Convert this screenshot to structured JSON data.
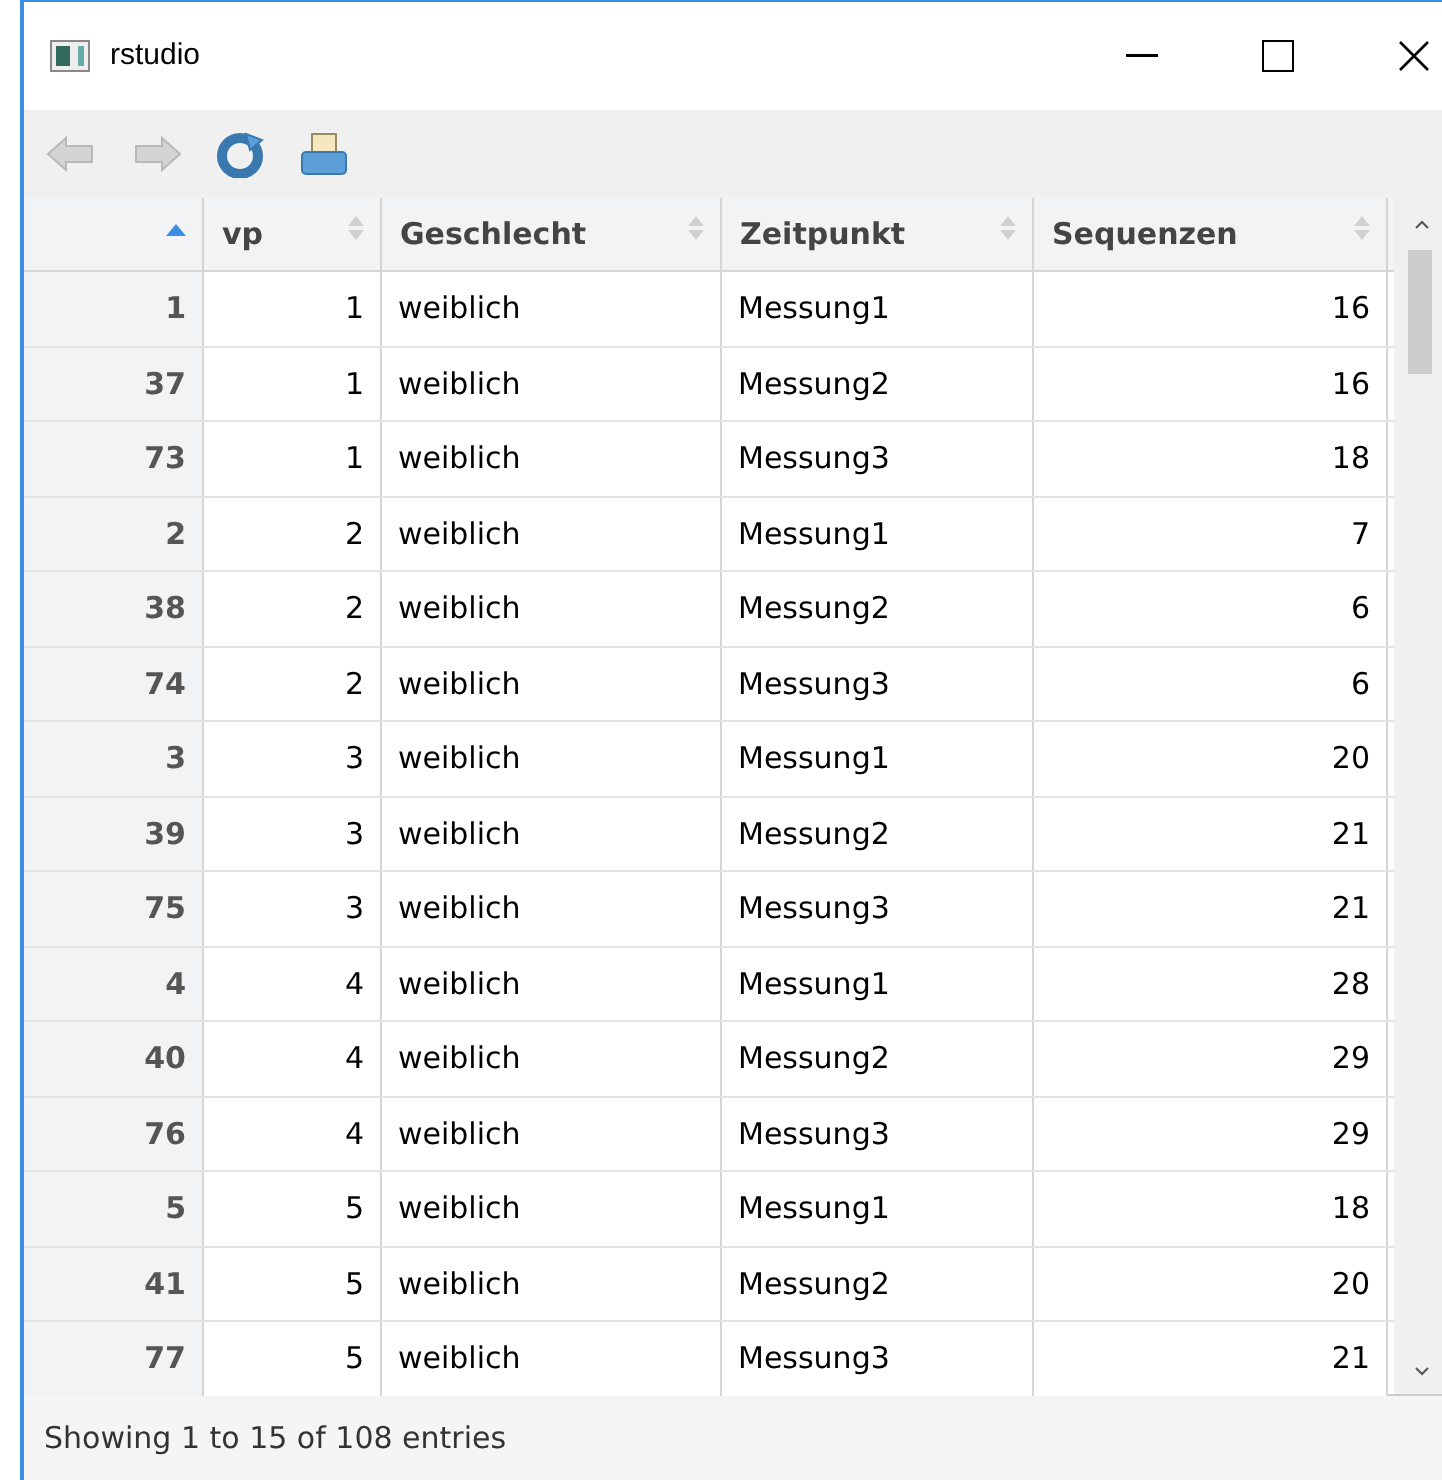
{
  "window": {
    "title": "rstudio"
  },
  "toolbar": [
    {
      "kind": "back",
      "disabled": true
    },
    {
      "kind": "forward",
      "disabled": true
    },
    {
      "kind": "refresh",
      "disabled": false
    },
    {
      "kind": "print",
      "disabled": false
    }
  ],
  "table": {
    "columns": [
      {
        "kind": "number",
        "sorted": true
      },
      {
        "label": "vp",
        "kind": "number",
        "sorted": false
      },
      {
        "label": "Geschlecht",
        "kind": "text",
        "sorted": false
      },
      {
        "label": "Zeitpunkt",
        "kind": "text",
        "sorted": false
      },
      {
        "label": "Sequenzen",
        "kind": "number",
        "sorted": false
      }
    ],
    "rows": [
      [
        "1",
        "1",
        "weiblich",
        "Messung1",
        "16"
      ],
      [
        "37",
        "1",
        "weiblich",
        "Messung2",
        "16"
      ],
      [
        "73",
        "1",
        "weiblich",
        "Messung3",
        "18"
      ],
      [
        "2",
        "2",
        "weiblich",
        "Messung1",
        "7"
      ],
      [
        "38",
        "2",
        "weiblich",
        "Messung2",
        "6"
      ],
      [
        "74",
        "2",
        "weiblich",
        "Messung3",
        "6"
      ],
      [
        "3",
        "3",
        "weiblich",
        "Messung1",
        "20"
      ],
      [
        "39",
        "3",
        "weiblich",
        "Messung2",
        "21"
      ],
      [
        "75",
        "3",
        "weiblich",
        "Messung3",
        "21"
      ],
      [
        "4",
        "4",
        "weiblich",
        "Messung1",
        "28"
      ],
      [
        "40",
        "4",
        "weiblich",
        "Messung2",
        "29"
      ],
      [
        "76",
        "4",
        "weiblich",
        "Messung3",
        "29"
      ],
      [
        "5",
        "5",
        "weiblich",
        "Messung1",
        "18"
      ],
      [
        "41",
        "5",
        "weiblich",
        "Messung2",
        "20"
      ],
      [
        "77",
        "5",
        "weiblich",
        "Messung3",
        "21"
      ]
    ]
  },
  "status_bar": "Showing 1 to 15 of 108 entries"
}
